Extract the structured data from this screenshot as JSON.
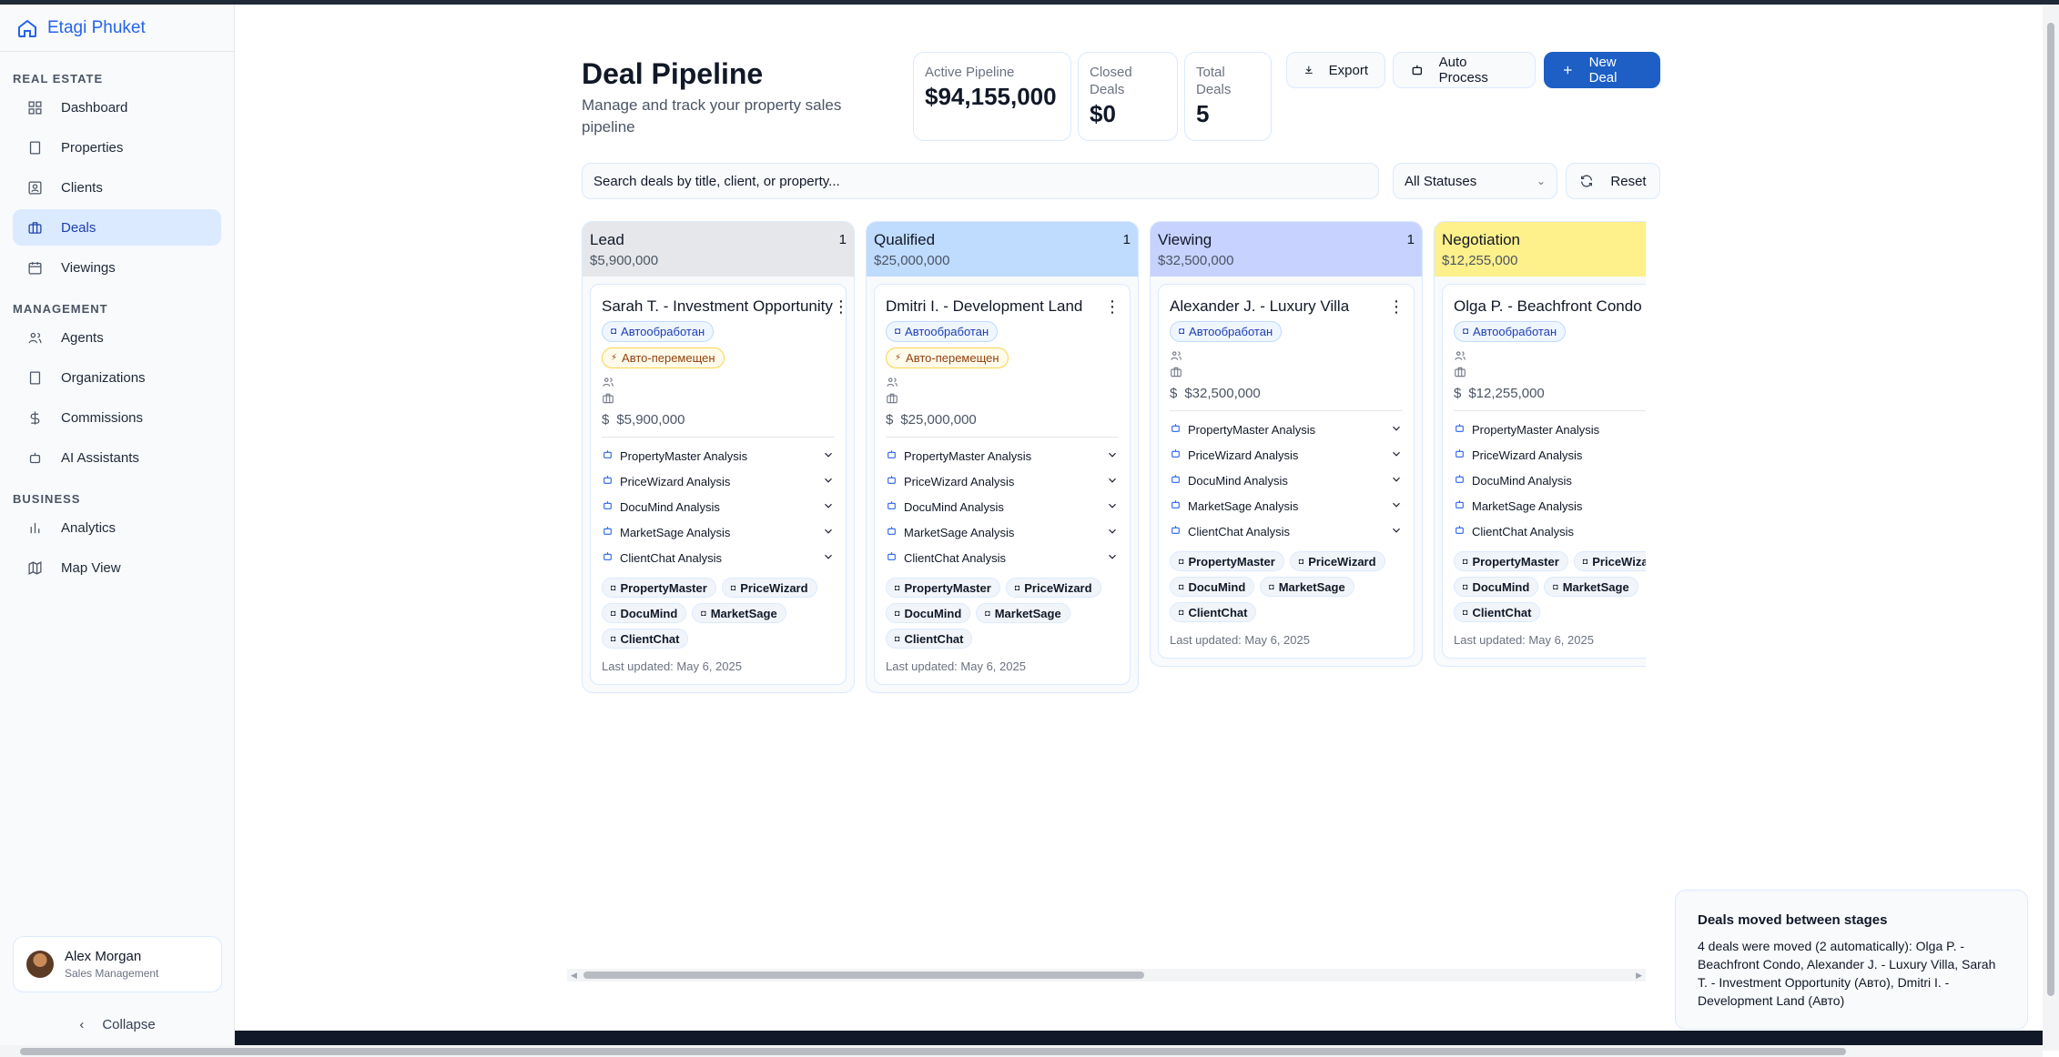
{
  "app": {
    "name": "Etagi Phuket"
  },
  "sidebar": {
    "sections": [
      {
        "title": "REAL ESTATE",
        "items": [
          {
            "label": "Dashboard",
            "icon": "dashboard-icon"
          },
          {
            "label": "Properties",
            "icon": "building-icon"
          },
          {
            "label": "Clients",
            "icon": "user-card-icon"
          },
          {
            "label": "Deals",
            "icon": "briefcase-icon",
            "active": true
          },
          {
            "label": "Viewings",
            "icon": "calendar-icon"
          }
        ]
      },
      {
        "title": "MANAGEMENT",
        "items": [
          {
            "label": "Agents",
            "icon": "users-icon"
          },
          {
            "label": "Organizations",
            "icon": "building-icon"
          },
          {
            "label": "Commissions",
            "icon": "dollar-icon"
          },
          {
            "label": "AI Assistants",
            "icon": "bot-icon"
          }
        ]
      },
      {
        "title": "BUSINESS",
        "items": [
          {
            "label": "Analytics",
            "icon": "bar-chart-icon"
          },
          {
            "label": "Map View",
            "icon": "map-icon"
          }
        ]
      }
    ],
    "user": {
      "name": "Alex Morgan",
      "role": "Sales Management"
    },
    "collapse_label": "Collapse"
  },
  "header": {
    "title": "Deal Pipeline",
    "subtitle": "Manage and track your property sales pipeline",
    "stats": [
      {
        "label": "Active Pipeline",
        "value": "$94,155,000"
      },
      {
        "label": "Closed Deals",
        "value": "$0"
      },
      {
        "label": "Total Deals",
        "value": "5"
      }
    ],
    "buttons": {
      "export": "Export",
      "auto_process": "Auto Process",
      "new_deal": "New Deal"
    }
  },
  "filters": {
    "search_placeholder": "Search deals by title, client, or property...",
    "status_selected": "All Statuses",
    "reset_label": "Reset"
  },
  "columns": [
    {
      "name": "Lead",
      "total": "$5,900,000",
      "count": "1",
      "color": "#e5e7eb",
      "card": {
        "title": "Sarah T. - Investment Opportunity",
        "badges": [
          "Автообработан",
          "Авто-перемещен"
        ],
        "price": "$5,900,000",
        "expanded": true
      }
    },
    {
      "name": "Qualified",
      "total": "$25,000,000",
      "count": "1",
      "color": "#bfdbfe",
      "card": {
        "title": "Dmitri I. - Development Land",
        "badges": [
          "Автообработан",
          "Авто-перемещен"
        ],
        "price": "$25,000,000",
        "expanded": true
      }
    },
    {
      "name": "Viewing",
      "total": "$32,500,000",
      "count": "1",
      "color": "#c7d2fe",
      "card": {
        "title": "Alexander J. - Luxury Villa",
        "badges": [
          "Автообработан"
        ],
        "price": "$32,500,000",
        "expanded": true
      }
    },
    {
      "name": "Negotiation",
      "total": "$12,255,000",
      "count": "",
      "color": "#fef08a",
      "card": {
        "title": "Olga P. - Beachfront Condo",
        "badges": [
          "Автообработан"
        ],
        "price": "$12,255,000",
        "expanded": false
      }
    }
  ],
  "analyses": [
    "PropertyMaster Analysis",
    "PriceWizard Analysis",
    "DocuMind Analysis",
    "MarketSage Analysis",
    "ClientChat Analysis"
  ],
  "assistant_chips": [
    "PropertyMaster",
    "PriceWizard",
    "DocuMind",
    "MarketSage",
    "ClientChat"
  ],
  "last_updated": "Last updated: May 6, 2025",
  "toast": {
    "title": "Deals moved between stages",
    "body": "4 deals were moved (2 automatically): Olga P. - Beachfront Condo, Alexander J. - Luxury Villa, Sarah T. - Investment Opportunity (Авто), Dmitri I. - Development Land (Авто)"
  }
}
